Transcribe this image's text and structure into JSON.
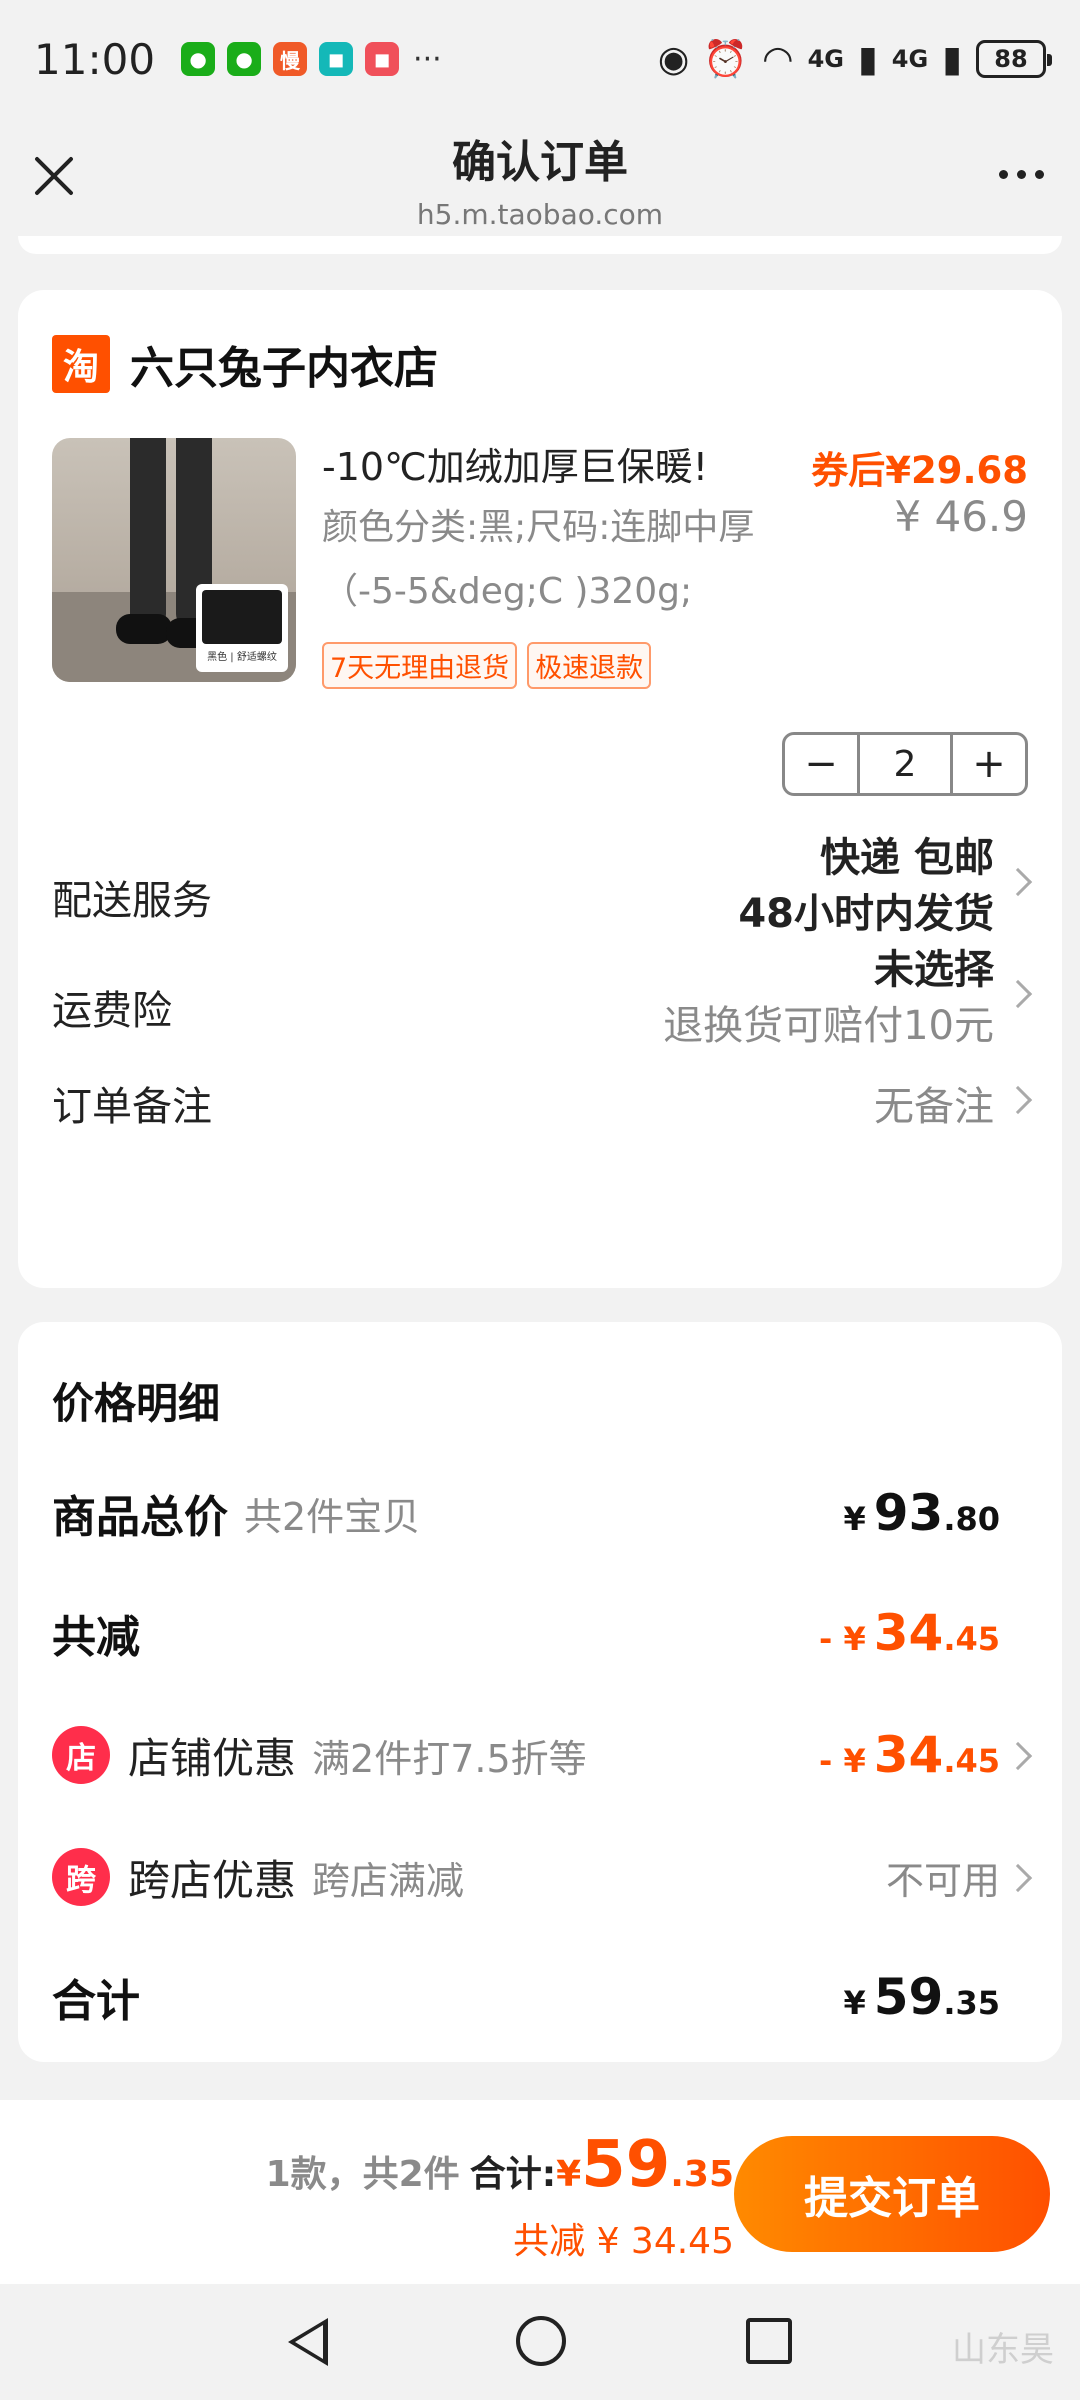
{
  "status_bar": {
    "time": "11:00",
    "app_badges": [
      {
        "icon": "wechat-icon",
        "glyph": "●",
        "color": "#1aad19"
      },
      {
        "icon": "wechat-icon",
        "glyph": "●",
        "color": "#1aad19"
      },
      {
        "icon": "man-app-icon",
        "glyph": "慢",
        "color": "#f05a28"
      },
      {
        "icon": "mi-app-icon",
        "glyph": "◼",
        "color": "#14b8b8"
      },
      {
        "icon": "huawei-app-icon",
        "glyph": "◼",
        "color": "#f0505a"
      }
    ],
    "more_dots": "···",
    "signal_1": "4G",
    "signal_2": "4G",
    "battery": "88"
  },
  "nav": {
    "title": "确认订单",
    "url": "h5.m.taobao.com"
  },
  "order_card": {
    "shop_logo_text": "淘",
    "shop_name": "六只兔子内衣店",
    "product": {
      "title": "-10℃加绒加厚巨保暖!",
      "sku": "颜色分类:黑;尺码:连脚中厚（-5-5&deg;C )320g;",
      "thumb_caption": "黑色 | 舒适螺纹",
      "tags": [
        "7天无理由退货",
        "极速退款"
      ],
      "price_after_coupon": "券后¥29.68",
      "price_original": "¥ 46.9"
    },
    "quantity": {
      "minus": "−",
      "value": "2",
      "plus": "+"
    },
    "delivery": {
      "label": "配送服务",
      "line1": "快递 包邮",
      "line2": "48小时内发货"
    },
    "insurance": {
      "label": "运费险",
      "line1": "未选择",
      "line2": "退换货可赔付10元"
    },
    "note": {
      "label": "订单备注",
      "value": "无备注"
    }
  },
  "price_card": {
    "title": "价格明细",
    "goods_total": {
      "label": "商品总价",
      "sub": "共2件宝贝",
      "currency": "¥",
      "int": "93",
      "dec": ".80"
    },
    "total_discount": {
      "label": "共减",
      "currency": "- ¥",
      "int": "34",
      "dec": ".45"
    },
    "shop_discount": {
      "icon_text": "店",
      "label": "店铺优惠",
      "sub": "满2件打7.5折等",
      "currency": "- ¥",
      "int": "34",
      "dec": ".45"
    },
    "cross_shop": {
      "icon_text": "跨",
      "label": "跨店优惠",
      "sub": "跨店满减",
      "value": "不可用"
    },
    "sum": {
      "label": "合计",
      "currency": "¥",
      "int": "59",
      "dec": ".35"
    }
  },
  "submit_bar": {
    "count": "1款，共2件",
    "total_label": "合计:",
    "currency": "¥",
    "int": "59",
    "dec": ".35",
    "discount": "共减 ¥ 34.45",
    "button": "提交订单"
  },
  "system_nav": {
    "watermark": "山东昊"
  },
  "colors": {
    "accent": "#ff5000",
    "accent_gradient_start": "#ff8a00",
    "discount_icon": "#ff2e4b",
    "background": "#f2f2f2"
  }
}
